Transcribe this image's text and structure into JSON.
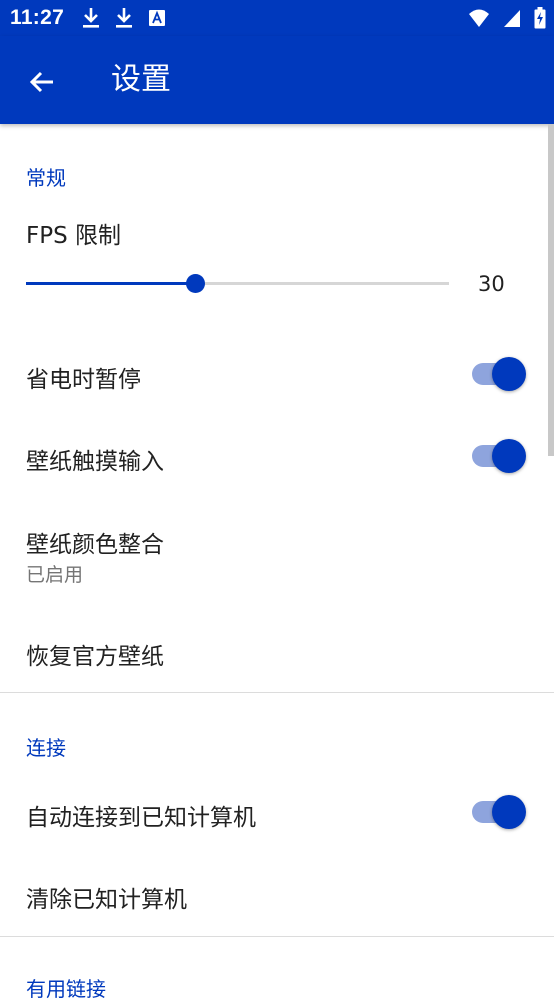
{
  "status_bar": {
    "time": "11:27",
    "left_icons": [
      "download-icon",
      "download-icon",
      "text-notification-icon"
    ],
    "right_icons": [
      "wifi-icon",
      "signal-icon",
      "battery-charging-icon"
    ]
  },
  "app_bar": {
    "title": "设置",
    "back_icon": "arrow-left-icon"
  },
  "colors": {
    "primary": "#0039bd",
    "switch_track": "#8ea4dd",
    "section_header": "#0039bd",
    "summary_text": "#757575"
  },
  "sections": {
    "general": {
      "header": "常规",
      "fps": {
        "title": "FPS 限制",
        "value": "30",
        "fill_fraction": 0.4
      },
      "pause_on_battery_saver": {
        "title": "省电时暂停",
        "enabled": true
      },
      "wallpaper_touch_input": {
        "title": "壁纸触摸输入",
        "enabled": true
      },
      "wallpaper_color_integration": {
        "title": "壁纸颜色整合",
        "summary": "已启用"
      },
      "restore_official_wallpaper": {
        "title": "恢复官方壁纸"
      }
    },
    "connection": {
      "header": "连接",
      "auto_connect": {
        "title": "自动连接到已知计算机",
        "enabled": true
      },
      "clear_known": {
        "title": "清除已知计算机"
      }
    },
    "links": {
      "header": "有用链接"
    }
  }
}
